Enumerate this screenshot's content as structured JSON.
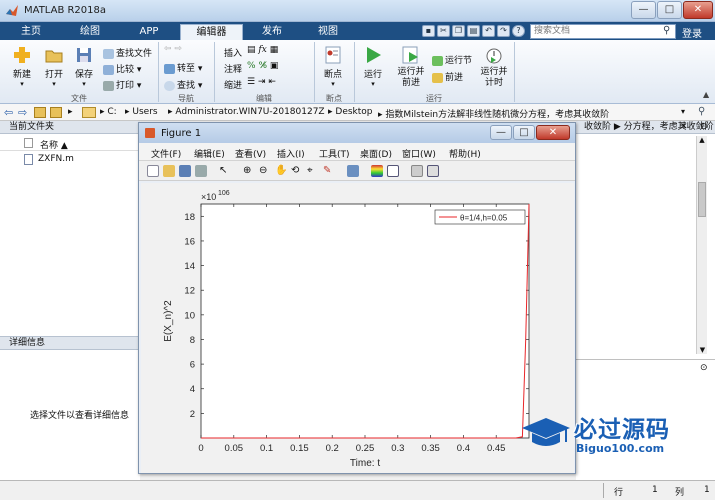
{
  "app": {
    "title": "MATLAB R2018a",
    "window_controls": {
      "minimize": "—",
      "maximize": "□",
      "close": "✕"
    }
  },
  "tabs": [
    "主页",
    "绘图",
    "APP",
    "编辑器",
    "发布",
    "视图"
  ],
  "active_tab": "编辑器",
  "search": {
    "placeholder": "搜索文档"
  },
  "login_label": "登录",
  "ribbon": {
    "file_group": {
      "label": "文件",
      "new": "新建",
      "open": "打开",
      "save": "保存",
      "find_files": "查找文件",
      "compare": "比较",
      "print": "打印"
    },
    "nav_group": {
      "label": "导航",
      "goto": "转至",
      "find": "查找"
    },
    "edit_group": {
      "label": "编辑",
      "insert": "插入",
      "comment": "注释",
      "indent": "缩进"
    },
    "breakpoint_group": {
      "label": "断点",
      "breakpoints": "断点"
    },
    "run_group": {
      "label": "运行",
      "run": "运行",
      "run_advance": "运行并前进",
      "run_section": "运行节",
      "advance": "前进",
      "run_time": "运行并计时"
    }
  },
  "address": {
    "path": [
      "C:",
      "Users",
      "Administrator.WIN7U-20180127Z",
      "Desktop",
      "指数Milstein方法解非线性随机微分方程，考虑其收敛阶"
    ]
  },
  "current_folder": {
    "header": "当前文件夹",
    "column_name": "名称 ▲",
    "files": [
      "ZXFN.m"
    ]
  },
  "details": {
    "header": "详细信息",
    "message": "选择文件以查看详细信息"
  },
  "back_panel": {
    "header_text": "收敛阶 ▶ 分方程，考虑其收敛阶"
  },
  "status": {
    "row_label": "行",
    "row_value": "1",
    "col_label": "列",
    "col_value": "1"
  },
  "figure": {
    "title": "Figure 1",
    "menus": [
      "文件(F)",
      "编辑(E)",
      "查看(V)",
      "插入(I)",
      "工具(T)",
      "桌面(D)",
      "窗口(W)",
      "帮助(H)"
    ],
    "toolbar_icons": [
      "new-icon",
      "open-icon",
      "save-icon",
      "print-icon",
      "pointer-icon",
      "zoom-in-icon",
      "zoom-out-icon",
      "pan-icon",
      "rotate-icon",
      "data-cursor-icon",
      "brush-icon",
      "link-icon",
      "colorbar-icon",
      "legend-icon",
      "hide-plot-tools-icon",
      "show-plot-tools-icon"
    ]
  },
  "chart_data": {
    "type": "line",
    "xlabel": "Time: t",
    "ylabel": "E(X_n)^2",
    "y_exponent_label": "×10",
    "y_exponent_power": "106",
    "xlim": [
      0,
      0.5
    ],
    "ylim": [
      0,
      19
    ],
    "x_ticks": [
      "0",
      "0.05",
      "0.1",
      "0.15",
      "0.2",
      "0.25",
      "0.3",
      "0.35",
      "0.4",
      "0.45"
    ],
    "y_ticks": [
      "2",
      "4",
      "6",
      "8",
      "10",
      "12",
      "14",
      "16",
      "18"
    ],
    "legend_position": "top-right",
    "series": [
      {
        "name": "θ=1/4,h=0.05",
        "color": "#e8262a",
        "x": [
          0,
          0.05,
          0.1,
          0.15,
          0.2,
          0.25,
          0.3,
          0.35,
          0.4,
          0.45,
          0.48,
          0.49,
          0.495,
          0.5
        ],
        "y": [
          0,
          0,
          0,
          0,
          0,
          0,
          0,
          0,
          0,
          0,
          0,
          0.1,
          8,
          19
        ]
      }
    ]
  },
  "watermark": {
    "text": "必过源码",
    "sub": "Biguo100.com",
    "accent": "#1a5fb4"
  }
}
